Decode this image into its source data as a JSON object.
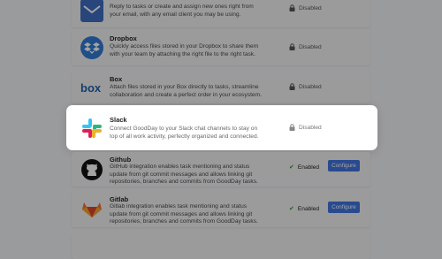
{
  "integrations": [
    {
      "key": "email",
      "title": "",
      "desc_lines": [
        "Reply to tasks or create and assign new ones right from",
        "your email, with any email client you may be using."
      ],
      "status": "Disabled",
      "enabled": false,
      "icon": "email-icon",
      "color": "#3d6cc7"
    },
    {
      "key": "dropbox",
      "title": "Dropbox",
      "desc_lines": [
        "Quickly access files stored in your Dropbox to share them",
        "with your team by attaching the right file to the right task."
      ],
      "status": "Disabled",
      "enabled": false,
      "icon": "dropbox-icon",
      "color": "#2f7bd8"
    },
    {
      "key": "box",
      "title": "Box",
      "desc_lines": [
        "Attach files stored in your Box directly to tasks, streamline",
        "collaboration and create a perfect order in your ecosystem."
      ],
      "status": "Disabled",
      "enabled": false,
      "icon": "box-icon",
      "color": "#1f5fb0"
    },
    {
      "key": "slack",
      "title": "Slack",
      "desc_lines": [
        "Connect GoodDay to your Slack chat channels to stay on",
        "top of all work activity, perfectly organized and connected."
      ],
      "status": "Disabled",
      "enabled": false,
      "icon": "slack-icon",
      "color": "#e01e5a"
    },
    {
      "key": "github",
      "title": "Github",
      "desc_lines": [
        "GitHub integration enables task mentioning and status",
        "update from git commit messages and allows linking git",
        "repositories, branches and commits from GoodDay tasks."
      ],
      "status": "Enabled",
      "enabled": true,
      "action": "Configure",
      "icon": "github-icon",
      "color": "#111111"
    },
    {
      "key": "gitlab",
      "title": "Gitlab",
      "desc_lines": [
        "Gitlab integration enables task mentioning and status",
        "update from git commit messages and allows linking git",
        "repositories, branches and commits from GoodDay tasks."
      ],
      "status": "Enabled",
      "enabled": true,
      "action": "Configure",
      "icon": "gitlab-icon",
      "color": "#e24329"
    }
  ],
  "colors": {
    "overlay": "#9a9b9d",
    "accent": "#3d74e6",
    "enabled_check": "#1e9e3a"
  }
}
